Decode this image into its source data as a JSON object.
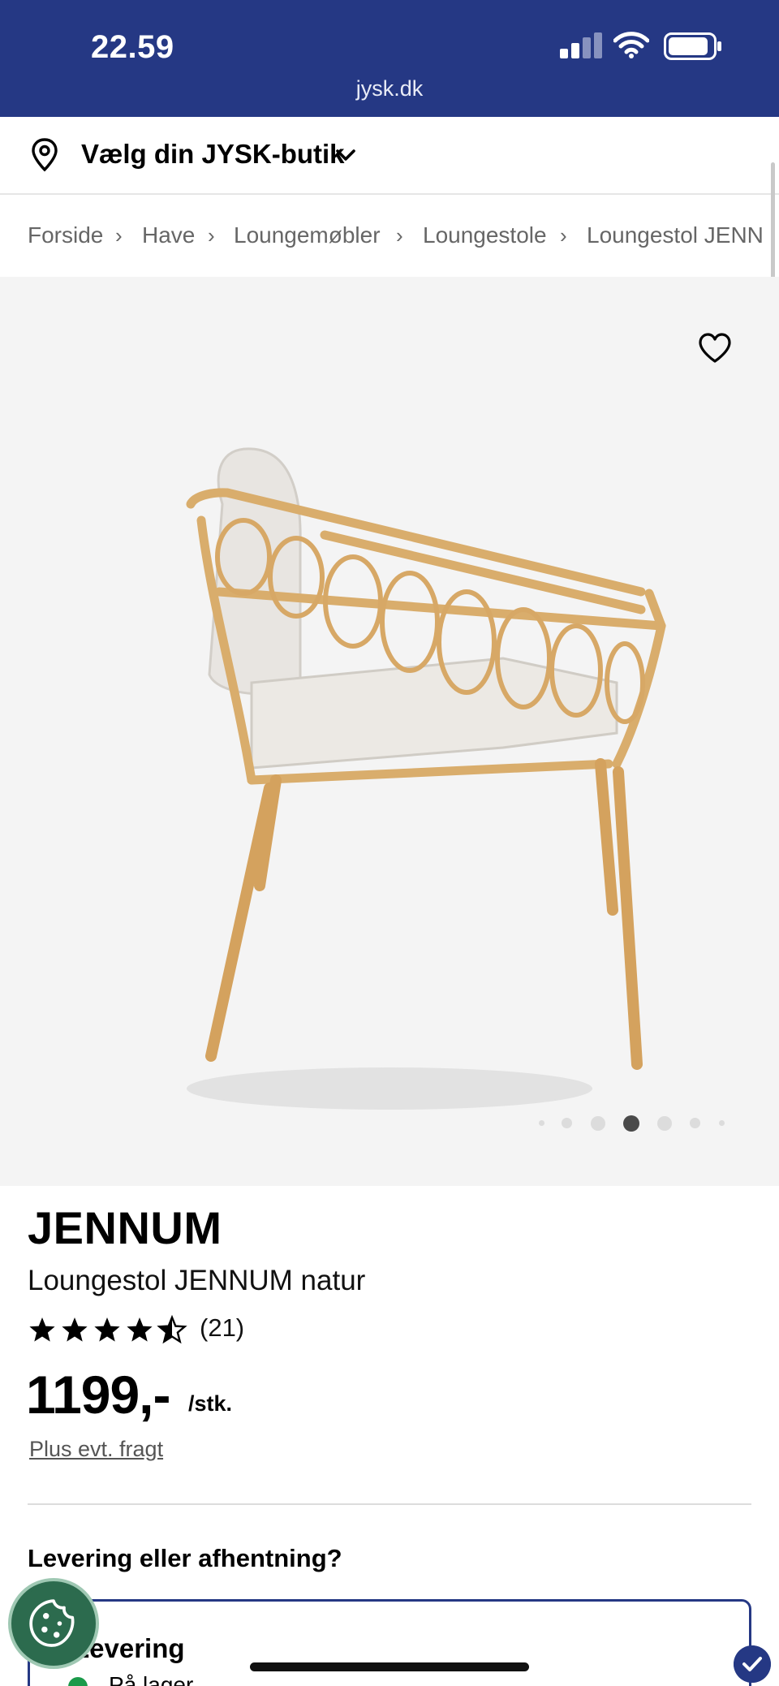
{
  "status_bar": {
    "time": "22.59",
    "url": "jysk.dk"
  },
  "store_selector": {
    "label": "Vælg din JYSK-butik",
    "icon": "location-pin-icon"
  },
  "breadcrumb": [
    "Forside",
    "Have",
    "Loungemøbler",
    "Loungestole",
    "Loungestol JENN"
  ],
  "gallery": {
    "active_index": 3,
    "total": 7
  },
  "product": {
    "brand": "JENNUM",
    "name": "Loungestol JENNUM natur",
    "rating": 4.5,
    "reviews": "(21)",
    "price": "1199,-",
    "unit": "/stk.",
    "shipping_note": "Plus evt. fragt"
  },
  "delivery": {
    "heading": "Levering eller afhentning?",
    "option_title": "Levering",
    "stock_text": "På lager"
  },
  "colors": {
    "brand_blue": "#253884",
    "in_stock_green": "#1a9a4a",
    "cookie_green": "#2c6b4e"
  }
}
